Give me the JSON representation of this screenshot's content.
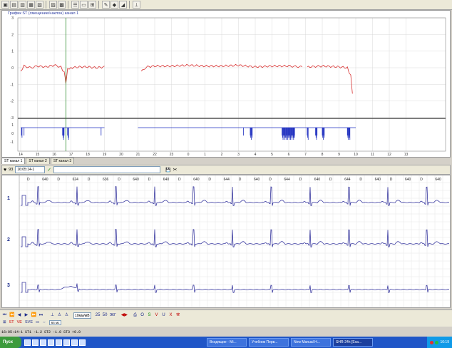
{
  "toolbar": {
    "icons": [
      "open-icon",
      "save-icon",
      "folder-icon",
      "print-icon",
      "layout-icon",
      "grid-icon",
      "table-icon",
      "list-icon",
      "pen-icon",
      "color-icon",
      "ruler-icon"
    ]
  },
  "st_chart": {
    "title": "График ST (смещение/наклон) канал 1",
    "y_ticks": [
      "3",
      "2",
      "1",
      "0",
      "-1",
      "-2",
      "-3"
    ],
    "x_ticks": [
      "14",
      "15",
      "16",
      "17",
      "18",
      "19",
      "20",
      "21",
      "22",
      "23",
      "0",
      "1",
      "2",
      "3",
      "4",
      "5",
      "6",
      "7",
      "8",
      "9",
      "10",
      "11",
      "12",
      "13"
    ],
    "lower_ticks": [
      "1",
      "0",
      "-1"
    ]
  },
  "chart_data": {
    "type": "line",
    "title": "График ST (смещение/наклон) канал 1",
    "x": [
      "14",
      "15",
      "16",
      "17",
      "18",
      "19",
      "20",
      "21",
      "22",
      "23",
      "0",
      "1",
      "2",
      "3",
      "4",
      "5",
      "6",
      "7",
      "8",
      "9",
      "10",
      "11",
      "12",
      "13"
    ],
    "ylim": [
      -3,
      3
    ],
    "xlabel": "",
    "ylabel": "",
    "series": [
      {
        "values": [
          [
            14.0,
            -0.2
          ],
          [
            14.2,
            0.1
          ],
          [
            14.6,
            0.0
          ],
          [
            15.0,
            0.1
          ],
          [
            15.5,
            0.05
          ],
          [
            16.0,
            0.15
          ],
          [
            16.4,
            0.05
          ],
          [
            16.6,
            -0.3
          ],
          [
            16.7,
            -0.9
          ],
          [
            16.8,
            -0.1
          ],
          [
            17.0,
            0.0
          ],
          [
            17.5,
            0.05
          ],
          [
            18.0,
            0.05
          ],
          [
            18.5,
            0.0
          ],
          [
            19.0,
            0.05
          ],
          [
            21.2,
            -0.2
          ],
          [
            21.5,
            0.05
          ],
          [
            22.0,
            0.1
          ],
          [
            23.0,
            0.1
          ],
          [
            24.0,
            0.15
          ],
          [
            25.0,
            0.1
          ],
          [
            26.0,
            0.1
          ],
          [
            27.0,
            0.15
          ],
          [
            28.0,
            0.05
          ],
          [
            29.0,
            0.1
          ],
          [
            30.0,
            0.1
          ],
          [
            30.8,
            0.05
          ],
          [
            31.1,
            0.05
          ],
          [
            32.0,
            0.1
          ],
          [
            33.0,
            0.05
          ],
          [
            33.5,
            0.0
          ],
          [
            33.7,
            -0.5
          ],
          [
            33.8,
            -1.5
          ]
        ]
      }
    ]
  },
  "tabs": [
    "ST канал 1",
    "ST канал 2",
    "ST канал 3"
  ],
  "ecg_bar": {
    "heart_rate": "93",
    "time": "16:05:14-1",
    "check": "✓",
    "save_label": "💾",
    "cut_label": "✂"
  },
  "ecg": {
    "channels": [
      "1",
      "2",
      "3"
    ],
    "rr_top": [
      "D",
      "640",
      "D",
      "624",
      "D",
      "636",
      "D",
      "640",
      "D",
      "640",
      "D",
      "640",
      "D",
      "644",
      "D",
      "640",
      "D",
      "644",
      "D",
      "640",
      "D",
      "644",
      "D",
      "640",
      "D",
      "640",
      "D",
      "640"
    ]
  },
  "controls": {
    "nav": [
      "⏮",
      "⏪",
      "◀",
      "▶",
      "⏩",
      "⏭"
    ],
    "speed_label": "10мм/мВ",
    "scale_label": "25",
    "scale2_label": "50",
    "channel_label": "ЭКГ",
    "markers": [
      "O",
      "S",
      "V",
      "U",
      "X"
    ],
    "dur_label": "64 мс"
  },
  "status": {
    "line": "16:05:14-1  ST1 -1.2  ST2 -1.0  ST3 +0.0",
    "rows": [
      [
        "ST",
        "VE",
        "SVE"
      ]
    ]
  },
  "taskbar": {
    "start_label": "Пуск",
    "tasks": [
      "Входящие - Mi...",
      "Учебник Перв...",
      "New Manual H...",
      "SHR-24h [Exa..."
    ],
    "clock": "16:19"
  }
}
